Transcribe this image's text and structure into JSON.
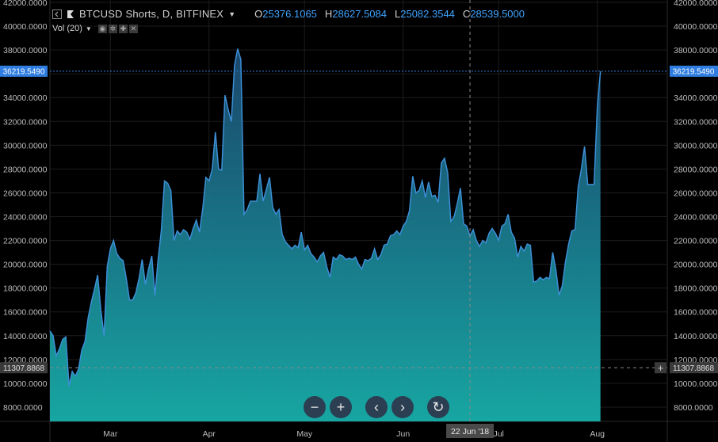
{
  "legend": {
    "symbol": "BTCUSD Shorts, D, BITFINEX",
    "open_label": "O",
    "open": "25376.1065",
    "high_label": "H",
    "high": "28627.5084",
    "low_label": "L",
    "low": "25082.3544",
    "close_label": "C",
    "close": "28539.5000"
  },
  "indicator": {
    "label": "Vol (20)"
  },
  "crosshair": {
    "date_label": "22 Jun '18",
    "price_label": "11307.8868"
  },
  "last_price": {
    "label": "36219.5490"
  },
  "colors": {
    "line": "#3c8fd6",
    "fill_top": "#1f5f86",
    "fill_bottom": "#15a9a4",
    "last": "#2f7de0"
  },
  "chart_data": {
    "type": "area",
    "title": "BTCUSD Shorts, D, BITFINEX",
    "x_tick_labels": [
      "Mar",
      "Apr",
      "May",
      "Jun",
      "Jul",
      "Aug"
    ],
    "y_tick_labels": [
      "8000.0000",
      "10000.0000",
      "12000.0000",
      "14000.0000",
      "16000.0000",
      "18000.0000",
      "20000.0000",
      "22000.0000",
      "24000.0000",
      "26000.0000",
      "28000.0000",
      "30000.0000",
      "32000.0000",
      "34000.0000",
      "36000.0000",
      "38000.0000",
      "40000.0000",
      "42000.0000"
    ],
    "ylim": [
      6800,
      42200
    ],
    "x_start": "2018-02-10",
    "x_end": "2018-08-23",
    "grid": true,
    "series": [
      {
        "values": [
          [
            "2018-02-10",
            14400
          ],
          [
            "2018-02-11",
            14000
          ],
          [
            "2018-02-12",
            12300
          ],
          [
            "2018-02-13",
            12900
          ],
          [
            "2018-02-14",
            13700
          ],
          [
            "2018-02-15",
            13900
          ],
          [
            "2018-02-16",
            9800
          ],
          [
            "2018-02-17",
            11000
          ],
          [
            "2018-02-18",
            10600
          ],
          [
            "2018-02-19",
            11200
          ],
          [
            "2018-02-20",
            12800
          ],
          [
            "2018-02-21",
            13500
          ],
          [
            "2018-02-22",
            15500
          ],
          [
            "2018-02-23",
            16800
          ],
          [
            "2018-02-24",
            17900
          ],
          [
            "2018-02-25",
            19100
          ],
          [
            "2018-02-26",
            16200
          ],
          [
            "2018-02-27",
            14000
          ],
          [
            "2018-02-28",
            19800
          ],
          [
            "2018-03-01",
            21300
          ],
          [
            "2018-03-02",
            22000
          ],
          [
            "2018-03-03",
            20900
          ],
          [
            "2018-03-04",
            20500
          ],
          [
            "2018-03-05",
            20300
          ],
          [
            "2018-03-06",
            18800
          ],
          [
            "2018-03-07",
            17000
          ],
          [
            "2018-03-08",
            17000
          ],
          [
            "2018-03-09",
            17600
          ],
          [
            "2018-03-10",
            18800
          ],
          [
            "2018-03-11",
            20400
          ],
          [
            "2018-03-12",
            18300
          ],
          [
            "2018-03-13",
            19600
          ],
          [
            "2018-03-14",
            20700
          ],
          [
            "2018-03-15",
            17400
          ],
          [
            "2018-03-16",
            20400
          ],
          [
            "2018-03-17",
            22800
          ],
          [
            "2018-03-18",
            27000
          ],
          [
            "2018-03-19",
            26800
          ],
          [
            "2018-03-20",
            26200
          ],
          [
            "2018-03-21",
            22000
          ],
          [
            "2018-03-22",
            22800
          ],
          [
            "2018-03-23",
            22500
          ],
          [
            "2018-03-24",
            22900
          ],
          [
            "2018-03-25",
            22700
          ],
          [
            "2018-03-26",
            22100
          ],
          [
            "2018-03-27",
            23000
          ],
          [
            "2018-03-28",
            23700
          ],
          [
            "2018-03-29",
            22700
          ],
          [
            "2018-03-30",
            24600
          ],
          [
            "2018-03-31",
            27300
          ],
          [
            "2018-04-01",
            27000
          ],
          [
            "2018-04-02",
            28000
          ],
          [
            "2018-04-03",
            31100
          ],
          [
            "2018-04-04",
            28000
          ],
          [
            "2018-04-05",
            27900
          ],
          [
            "2018-04-06",
            34200
          ],
          [
            "2018-04-07",
            33000
          ],
          [
            "2018-04-08",
            32000
          ],
          [
            "2018-04-09",
            36700
          ],
          [
            "2018-04-10",
            38100
          ],
          [
            "2018-04-11",
            37200
          ],
          [
            "2018-04-12",
            24200
          ],
          [
            "2018-04-13",
            24600
          ],
          [
            "2018-04-14",
            25300
          ],
          [
            "2018-04-15",
            25300
          ],
          [
            "2018-04-16",
            25300
          ],
          [
            "2018-04-17",
            27600
          ],
          [
            "2018-04-18",
            25300
          ],
          [
            "2018-04-19",
            26300
          ],
          [
            "2018-04-20",
            27300
          ],
          [
            "2018-04-21",
            24800
          ],
          [
            "2018-04-22",
            24200
          ],
          [
            "2018-04-23",
            24600
          ],
          [
            "2018-04-24",
            22500
          ],
          [
            "2018-04-25",
            21900
          ],
          [
            "2018-04-26",
            21600
          ],
          [
            "2018-04-27",
            21300
          ],
          [
            "2018-04-28",
            21600
          ],
          [
            "2018-04-29",
            21400
          ],
          [
            "2018-04-30",
            22700
          ],
          [
            "2018-05-01",
            21200
          ],
          [
            "2018-05-02",
            21600
          ],
          [
            "2018-05-03",
            20900
          ],
          [
            "2018-05-04",
            20600
          ],
          [
            "2018-05-05",
            20200
          ],
          [
            "2018-05-06",
            20700
          ],
          [
            "2018-05-07",
            21000
          ],
          [
            "2018-05-08",
            19800
          ],
          [
            "2018-05-09",
            18900
          ],
          [
            "2018-05-10",
            20600
          ],
          [
            "2018-05-11",
            20400
          ],
          [
            "2018-05-12",
            20800
          ],
          [
            "2018-05-13",
            20700
          ],
          [
            "2018-05-14",
            20400
          ],
          [
            "2018-05-15",
            20500
          ],
          [
            "2018-05-16",
            20400
          ],
          [
            "2018-05-17",
            20600
          ],
          [
            "2018-05-18",
            20000
          ],
          [
            "2018-05-19",
            19600
          ],
          [
            "2018-05-20",
            20400
          ],
          [
            "2018-05-21",
            20300
          ],
          [
            "2018-05-22",
            20500
          ],
          [
            "2018-05-23",
            21300
          ],
          [
            "2018-05-24",
            20400
          ],
          [
            "2018-05-25",
            20800
          ],
          [
            "2018-05-26",
            21600
          ],
          [
            "2018-05-27",
            21700
          ],
          [
            "2018-05-28",
            22400
          ],
          [
            "2018-05-29",
            22500
          ],
          [
            "2018-05-30",
            22800
          ],
          [
            "2018-05-31",
            22500
          ],
          [
            "2018-06-01",
            23200
          ],
          [
            "2018-06-02",
            23600
          ],
          [
            "2018-06-03",
            24500
          ],
          [
            "2018-06-04",
            27400
          ],
          [
            "2018-06-05",
            26000
          ],
          [
            "2018-06-06",
            26200
          ],
          [
            "2018-06-07",
            27000
          ],
          [
            "2018-06-08",
            25600
          ],
          [
            "2018-06-09",
            26900
          ],
          [
            "2018-06-10",
            25700
          ],
          [
            "2018-06-11",
            25800
          ],
          [
            "2018-06-12",
            25200
          ],
          [
            "2018-06-13",
            28500
          ],
          [
            "2018-06-14",
            28900
          ],
          [
            "2018-06-15",
            27700
          ],
          [
            "2018-06-16",
            23600
          ],
          [
            "2018-06-17",
            24000
          ],
          [
            "2018-06-18",
            25100
          ],
          [
            "2018-06-19",
            26400
          ],
          [
            "2018-06-20",
            23400
          ],
          [
            "2018-06-21",
            23200
          ],
          [
            "2018-06-22",
            22400
          ],
          [
            "2018-06-23",
            22900
          ],
          [
            "2018-06-24",
            22000
          ],
          [
            "2018-06-25",
            21500
          ],
          [
            "2018-06-26",
            22000
          ],
          [
            "2018-06-27",
            21800
          ],
          [
            "2018-06-28",
            22600
          ],
          [
            "2018-06-29",
            23000
          ],
          [
            "2018-06-30",
            22600
          ],
          [
            "2018-07-01",
            22000
          ],
          [
            "2018-07-02",
            23200
          ],
          [
            "2018-07-03",
            23400
          ],
          [
            "2018-07-04",
            24200
          ],
          [
            "2018-07-05",
            22700
          ],
          [
            "2018-07-06",
            22200
          ],
          [
            "2018-07-07",
            20600
          ],
          [
            "2018-07-08",
            21500
          ],
          [
            "2018-07-09",
            21100
          ],
          [
            "2018-07-10",
            21700
          ],
          [
            "2018-07-11",
            21600
          ],
          [
            "2018-07-12",
            18500
          ],
          [
            "2018-07-13",
            18600
          ],
          [
            "2018-07-14",
            18900
          ],
          [
            "2018-07-15",
            18700
          ],
          [
            "2018-07-16",
            18900
          ],
          [
            "2018-07-17",
            18800
          ],
          [
            "2018-07-18",
            21000
          ],
          [
            "2018-07-19",
            19500
          ],
          [
            "2018-07-20",
            17400
          ],
          [
            "2018-07-21",
            18200
          ],
          [
            "2018-07-22",
            20200
          ],
          [
            "2018-07-23",
            21700
          ],
          [
            "2018-07-24",
            22800
          ],
          [
            "2018-07-25",
            22900
          ],
          [
            "2018-07-26",
            26500
          ],
          [
            "2018-07-27",
            28000
          ],
          [
            "2018-07-28",
            29900
          ],
          [
            "2018-07-29",
            26700
          ],
          [
            "2018-07-30",
            26700
          ],
          [
            "2018-07-31",
            26700
          ],
          [
            "2018-08-01",
            33200
          ],
          [
            "2018-08-02",
            36219.549
          ]
        ]
      }
    ]
  }
}
